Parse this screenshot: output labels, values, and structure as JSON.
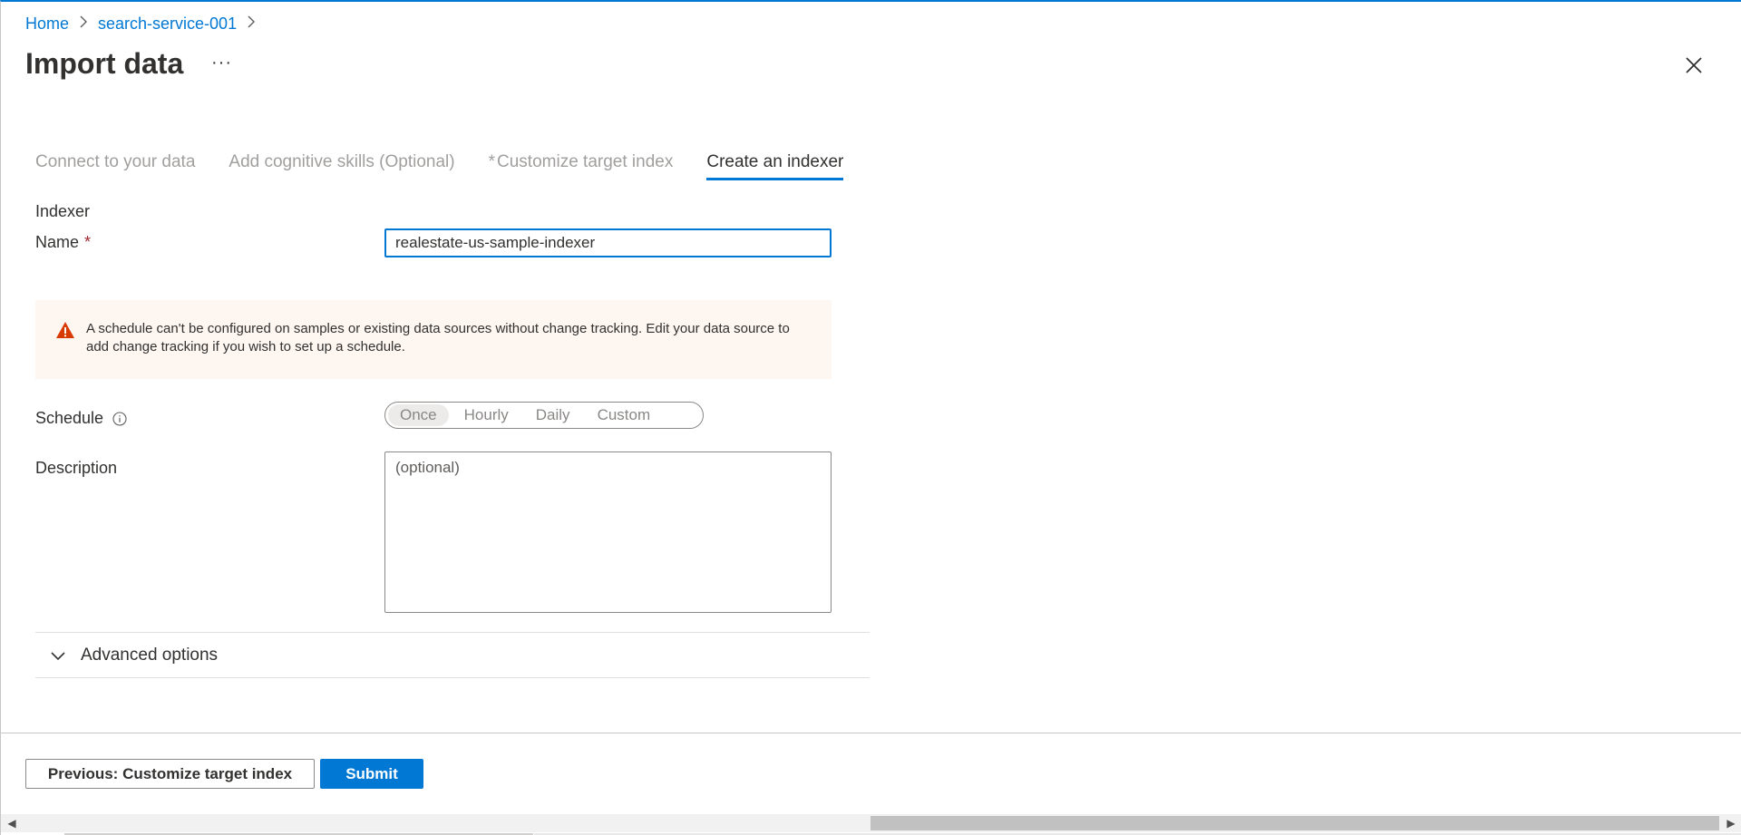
{
  "breadcrumb": {
    "home": "Home",
    "service": "search-service-001"
  },
  "header": {
    "title": "Import data",
    "more": "···"
  },
  "tabs": [
    {
      "label": "Connect to your data",
      "required": false,
      "active": false
    },
    {
      "label": "Add cognitive skills (Optional)",
      "required": false,
      "active": false
    },
    {
      "label": "Customize target index",
      "required": true,
      "active": false
    },
    {
      "label": "Create an indexer",
      "required": false,
      "active": true
    }
  ],
  "tab_required_marker": "*",
  "form": {
    "section_title": "Indexer",
    "name_label": "Name",
    "required_marker": "*",
    "name_value": "realestate-us-sample-indexer",
    "warning_text": "A schedule can't be configured on samples or existing data sources without change tracking. Edit your data source to add change tracking if you wish to set up a schedule.",
    "schedule_label": "Schedule",
    "schedule_options": [
      "Once",
      "Hourly",
      "Daily",
      "Custom"
    ],
    "schedule_selected": "Once",
    "description_label": "Description",
    "description_placeholder": "(optional)",
    "advanced_label": "Advanced options"
  },
  "footer": {
    "previous_label": "Previous: Customize target index",
    "submit_label": "Submit"
  },
  "colors": {
    "accent": "#0078d4",
    "warning_bg": "#fdf6f1",
    "warning_icon": "#d83b01",
    "required": "#a4262c"
  },
  "icons": {
    "breadcrumb_separator": "chevron-right-icon",
    "close": "close-icon",
    "warning": "warning-icon",
    "info": "info-icon",
    "advanced": "chevron-down-icon"
  },
  "scrollbar": {
    "left_arrow": "◀",
    "right_arrow": "▶"
  }
}
